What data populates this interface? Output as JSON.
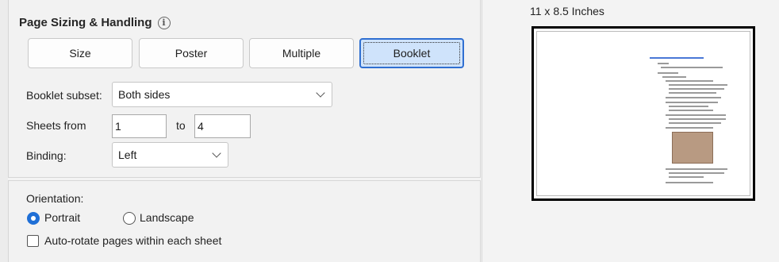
{
  "section": {
    "title": "Page Sizing & Handling",
    "info_icon": "info-icon"
  },
  "mode_buttons": [
    {
      "label": "Size",
      "active": false
    },
    {
      "label": "Poster",
      "active": false
    },
    {
      "label": "Multiple",
      "active": false
    },
    {
      "label": "Booklet",
      "active": true
    }
  ],
  "booklet_subset": {
    "label": "Booklet subset:",
    "value": "Both sides"
  },
  "sheets": {
    "label": "Sheets from",
    "from": "1",
    "to_label": "to",
    "to": "4"
  },
  "binding": {
    "label": "Binding:",
    "value": "Left"
  },
  "orientation": {
    "label": "Orientation:",
    "portrait": "Portrait",
    "landscape": "Landscape",
    "selected": "portrait"
  },
  "auto_rotate": {
    "label": "Auto-rotate pages within each sheet",
    "checked": false
  },
  "preview": {
    "size_label": "11 x 8.5 Inches"
  },
  "colors": {
    "accent": "#1f6fd6",
    "active_button_bg": "#cfe3fb"
  }
}
